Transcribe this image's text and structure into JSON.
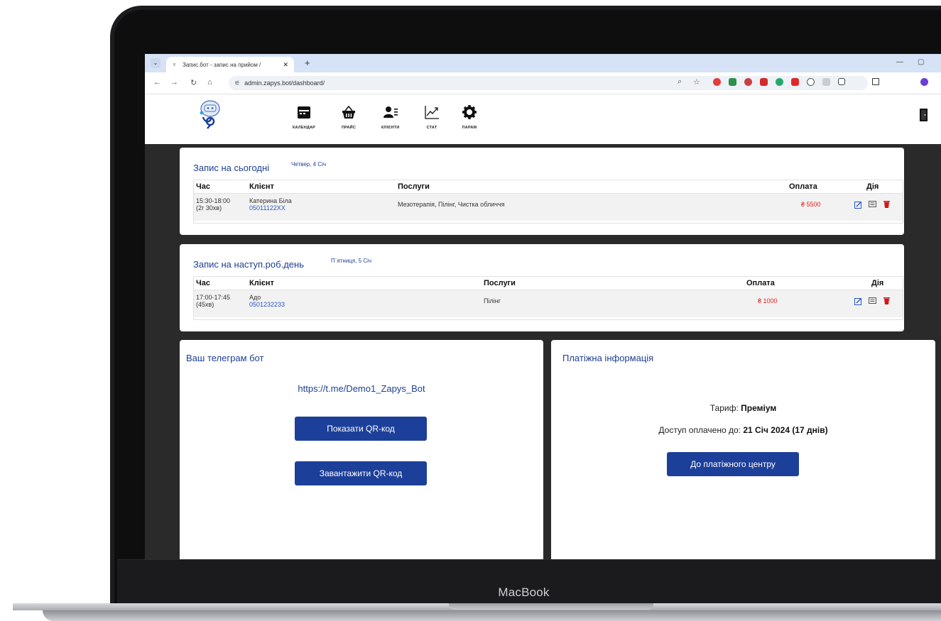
{
  "device": {
    "brand": "MacBook"
  },
  "browser": {
    "tab_title": "Запис.бот - запис на прийом / ",
    "url": "admin.zapys.bot/dashboard/"
  },
  "nav": {
    "items": [
      {
        "label": "КАЛЕНДАР",
        "icon": "calendar-icon"
      },
      {
        "label": "ПРАЙС",
        "icon": "basket-icon"
      },
      {
        "label": "КЛІЄНТИ",
        "icon": "clients-icon"
      },
      {
        "label": "СТАТ",
        "icon": "chart-icon"
      },
      {
        "label": "ПАРАМ",
        "icon": "gear-icon"
      }
    ]
  },
  "today": {
    "title": "Запис на сьогодні",
    "date": "Четвер, 4 Січ",
    "headers": {
      "time": "Час",
      "client": "Клієнт",
      "services": "Послуги",
      "payment": "Оплата",
      "action": "Дія"
    },
    "rows": [
      {
        "time": "15:30-18:00",
        "duration": "(2г 30хв)",
        "client": "Катерина Біла",
        "phone": "05011122XX",
        "services": "Мезотерапія, Пілінг, Чистка обличчя",
        "price": "₴ 5500"
      }
    ]
  },
  "next_day": {
    "title": "Запис на наступ.роб.день",
    "date": "П`ятниця, 5 Січ",
    "headers": {
      "time": "Час",
      "client": "Клієнт",
      "services": "Послуги",
      "payment": "Оплата",
      "action": "Дія"
    },
    "rows": [
      {
        "time": "17:00-17:45",
        "duration": "(45хв)",
        "client": "Адо",
        "phone": "0501232233",
        "services": "Пілінг",
        "price": "₴ 1000"
      }
    ]
  },
  "telegram": {
    "title": "Ваш телеграм бот",
    "link": "https://t.me/Demo1_Zapys_Bot",
    "show_qr": "Показати QR-код",
    "download_qr": "Завантажити QR-код"
  },
  "payment": {
    "title": "Платіжна інформація",
    "tariff_label": "Тариф:",
    "tariff_value": "Преміум",
    "access_label": "Доступ оплачено до:",
    "access_value": "21 Січ 2024 (17 днів)",
    "center_button": "До платіжного центру"
  },
  "colors": {
    "accent": "#1c3f99",
    "price": "#e02020",
    "phone": "#2b56c4"
  }
}
